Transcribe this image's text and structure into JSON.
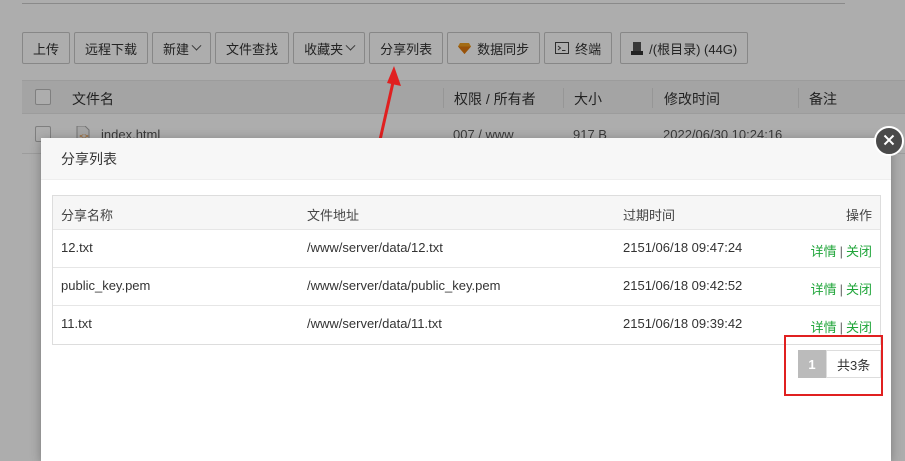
{
  "toolbar": {
    "upload": "上传",
    "remote_download": "远程下载",
    "new": "新建",
    "file_search": "文件查找",
    "favorites": "收藏夹",
    "share_list": "分享列表",
    "data_sync": "数据同步",
    "terminal": "终端",
    "disk": "/(根目录) (44G)"
  },
  "file_table": {
    "headers": [
      "文件名",
      "权限 / 所有者",
      "大小",
      "修改时间",
      "备注"
    ],
    "row": {
      "name": "index.html",
      "perm": "007 / www",
      "size": "917 B",
      "mtime": "2022/06/30 10:24:16"
    }
  },
  "modal": {
    "title": "分享列表",
    "columns": {
      "name": "分享名称",
      "path": "文件地址",
      "expire": "过期时间",
      "actions": "操作"
    },
    "rows": [
      {
        "name": "12.txt",
        "path": "/www/server/data/12.txt",
        "expire": "2151/06/18 09:47:24",
        "detail": "详情",
        "close": "关闭"
      },
      {
        "name": "public_key.pem",
        "path": "/www/server/data/public_key.pem",
        "expire": "2151/06/18 09:42:52",
        "detail": "详情",
        "close": "关闭"
      },
      {
        "name": "11.txt",
        "path": "/www/server/data/11.txt",
        "expire": "2151/06/18 09:39:42",
        "detail": "详情",
        "close": "关闭"
      }
    ],
    "action_separator": "|",
    "pager": {
      "current": "1",
      "total": "共3条"
    }
  },
  "colors": {
    "accent_green": "#20a53a",
    "highlight_red": "#e02020"
  }
}
